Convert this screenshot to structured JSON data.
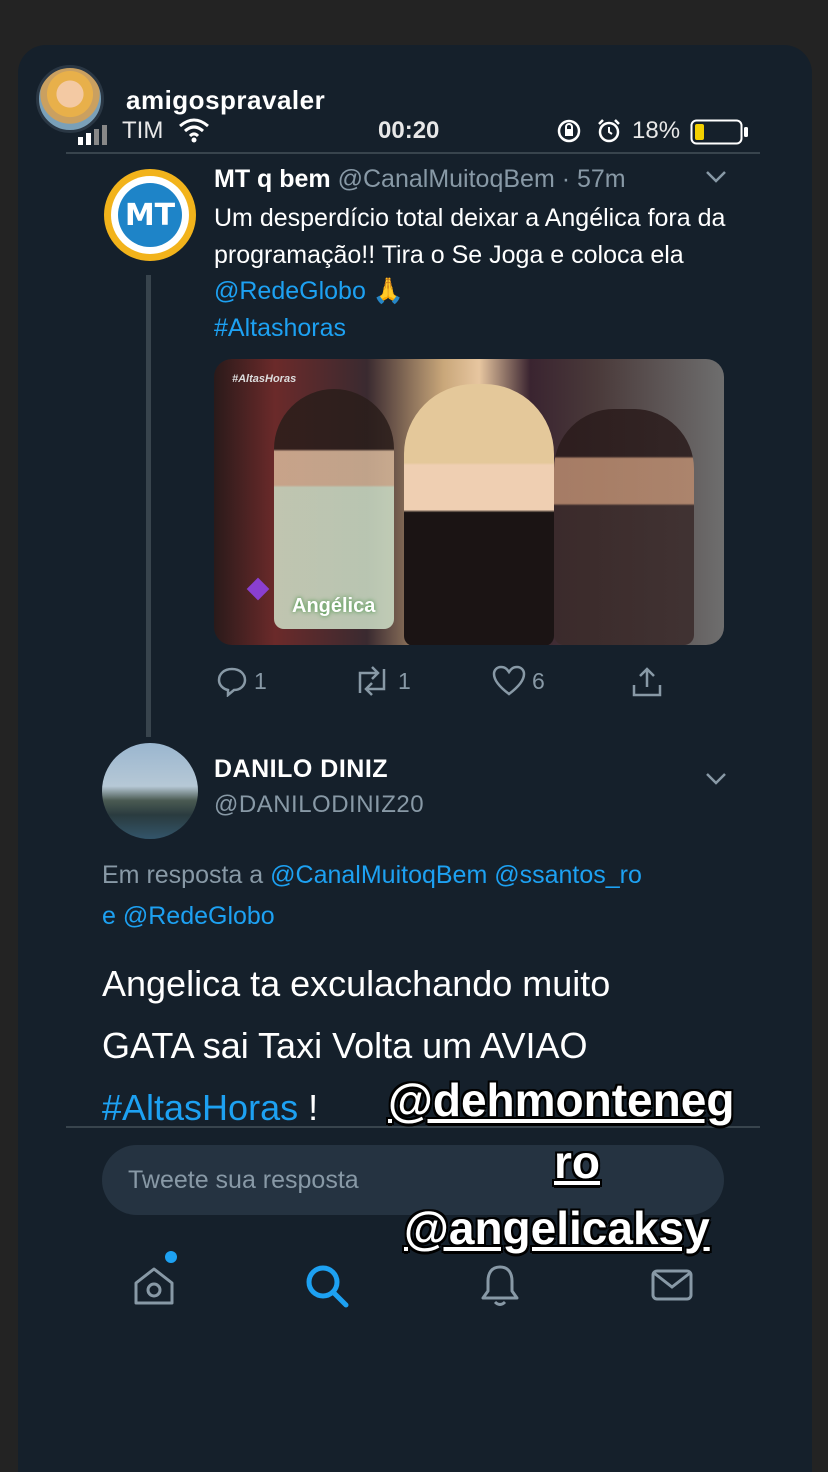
{
  "story": {
    "username": "amigospravaler"
  },
  "status_bar": {
    "carrier": "TIM",
    "time": "00:20",
    "battery": "18%"
  },
  "tweet": {
    "display_name": "MT q bem",
    "handle_time": "@CanalMuitoqBem · 57m",
    "avatar_text": "MT",
    "text_plain": "Um desperdício total deixar a Angélica fora da programação!! Tira o Se Joga e coloca ela ",
    "mention": "@RedeGlobo",
    "emoji": "🙏",
    "hashtag": "#Altashoras",
    "media_overlay_tag": "#AltasHoras",
    "media_caption": "Angélica",
    "reply_count": "1",
    "retweet_count": "1",
    "like_count": "6"
  },
  "reply": {
    "display_name": "DANILO DINIZ",
    "handle": "@DANILODINIZ20",
    "in_reply_prefix": "Em resposta a ",
    "in_reply_mentions_1": "@CanalMuitoqBem @ssantos_ro",
    "in_reply_conj": "e ",
    "in_reply_mentions_2": "@RedeGlobo",
    "text_line1": "Angelica ta exculachando muito",
    "text_line2": "GATA sai Taxi Volta um AVIAO",
    "hashtag": "#AltasHoras",
    "text_end": " !"
  },
  "compose": {
    "placeholder": "Tweete sua resposta"
  },
  "stickers": {
    "mention1_part1": "@dehmonteneg",
    "mention1_part2": "ro",
    "mention2": "@angelicaksy"
  },
  "nav": {
    "items": [
      "home-icon",
      "search-icon",
      "notifications-icon",
      "messages-icon"
    ],
    "active": "search-icon"
  },
  "colors": {
    "background": "#15202b",
    "accent": "#1da1f2",
    "muted": "#8899a6"
  }
}
